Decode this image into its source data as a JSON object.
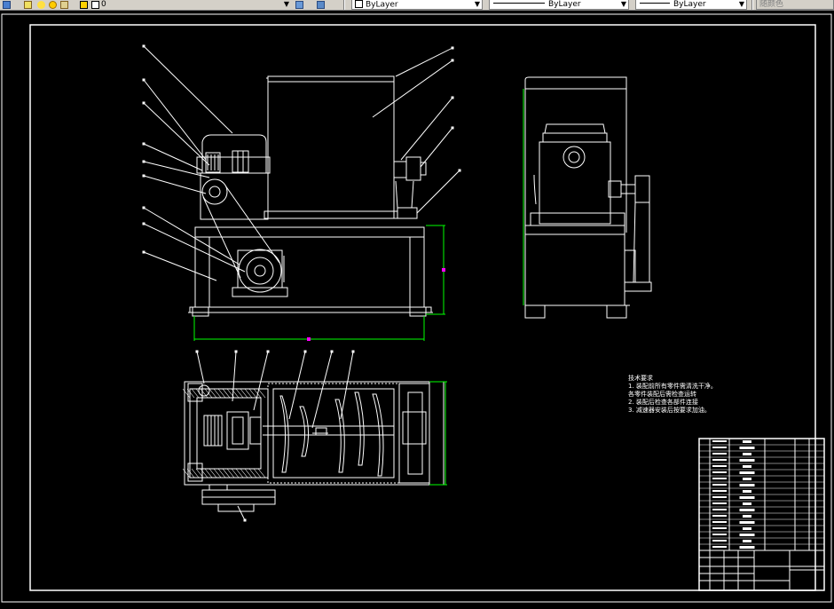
{
  "toolbar": {
    "layer_value": "0",
    "color_value": "ByLayer",
    "linetype_value": "ByLayer",
    "lineweight_value": "ByLayer",
    "plotstyle_value": "随颜色",
    "icons": [
      "layer-manager-icon",
      "layer-state-icon",
      "lightbulb-icon",
      "sun-icon",
      "lock-icon",
      "color-swatch-icon",
      "make-current-icon",
      "layer-previous-icon"
    ]
  },
  "colors": {
    "background": "#000000",
    "linework": "#ffffff",
    "dimension": "#00ff00",
    "grip": "#ff00ff",
    "toolbar": "#d4d0c8"
  },
  "drawing": {
    "notes_title": "技术要求",
    "notes": [
      "1. 装配前所有零件需清洗干净。",
      "各零件装配后需检查运转",
      "2. 装配后检查各部件连接",
      "3. 减速器安装后按要求加油。"
    ]
  }
}
